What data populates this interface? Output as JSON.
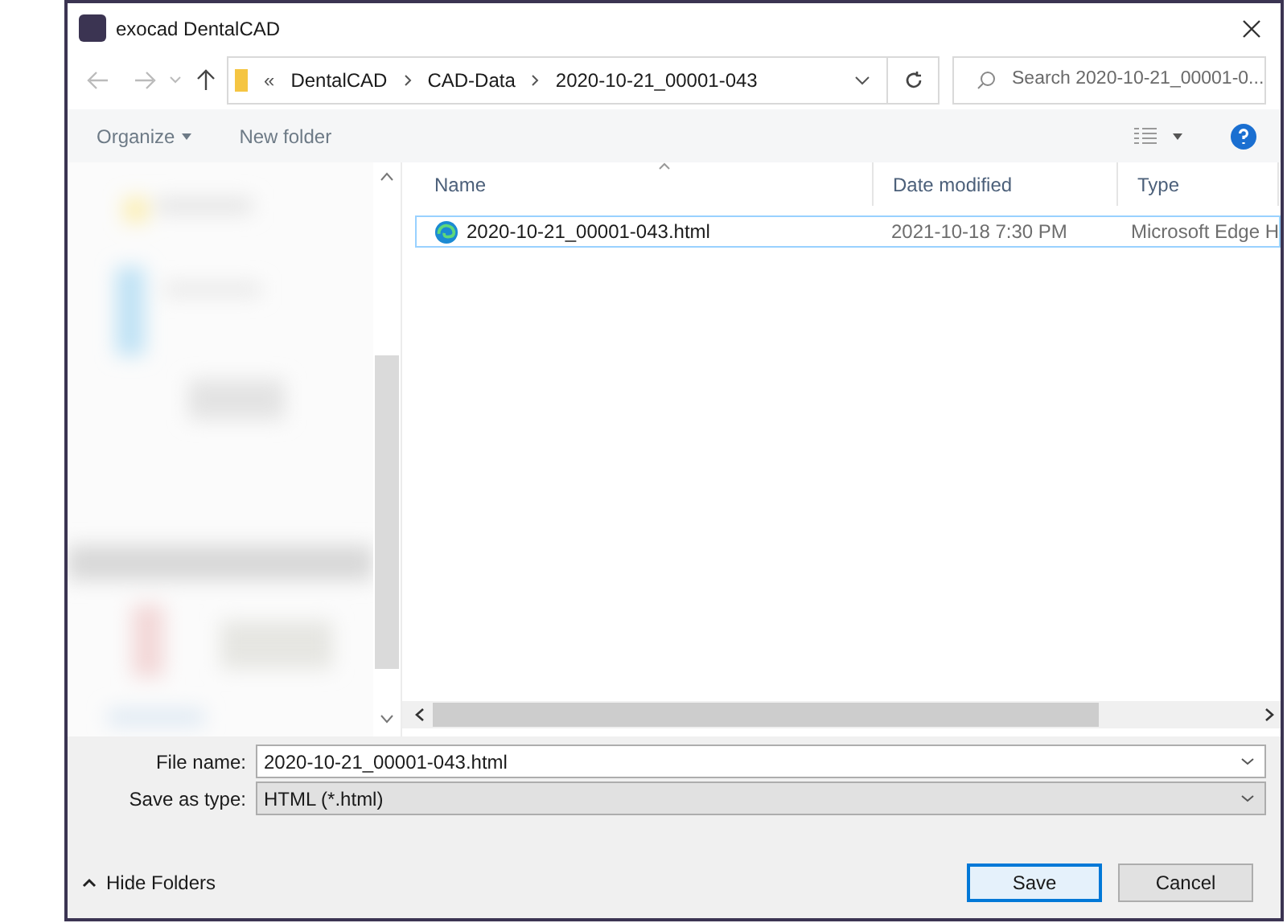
{
  "window": {
    "title": "exocad DentalCAD"
  },
  "address_bar": {
    "overflow": "«",
    "path": [
      "DentalCAD",
      "CAD-Data",
      "2020-10-21_00001-043"
    ]
  },
  "search": {
    "placeholder": "Search 2020-10-21_00001-0..."
  },
  "toolbar": {
    "organize": "Organize",
    "new_folder": "New folder"
  },
  "file_list": {
    "columns": [
      "Name",
      "Date modified",
      "Type"
    ],
    "rows": [
      {
        "name": "2020-10-21_00001-043.html",
        "date_modified": "2021-10-18 7:30 PM",
        "type": "Microsoft Edge H",
        "selected": true
      }
    ]
  },
  "file_name": {
    "label": "File name:",
    "value": "2020-10-21_00001-043.html"
  },
  "save_as_type": {
    "label": "Save as type:",
    "value": "HTML (*.html)"
  },
  "hide_folders": "Hide Folders",
  "buttons": [
    {
      "label": "Save",
      "kind": "default"
    },
    {
      "label": "Cancel",
      "kind": "normal"
    }
  ]
}
